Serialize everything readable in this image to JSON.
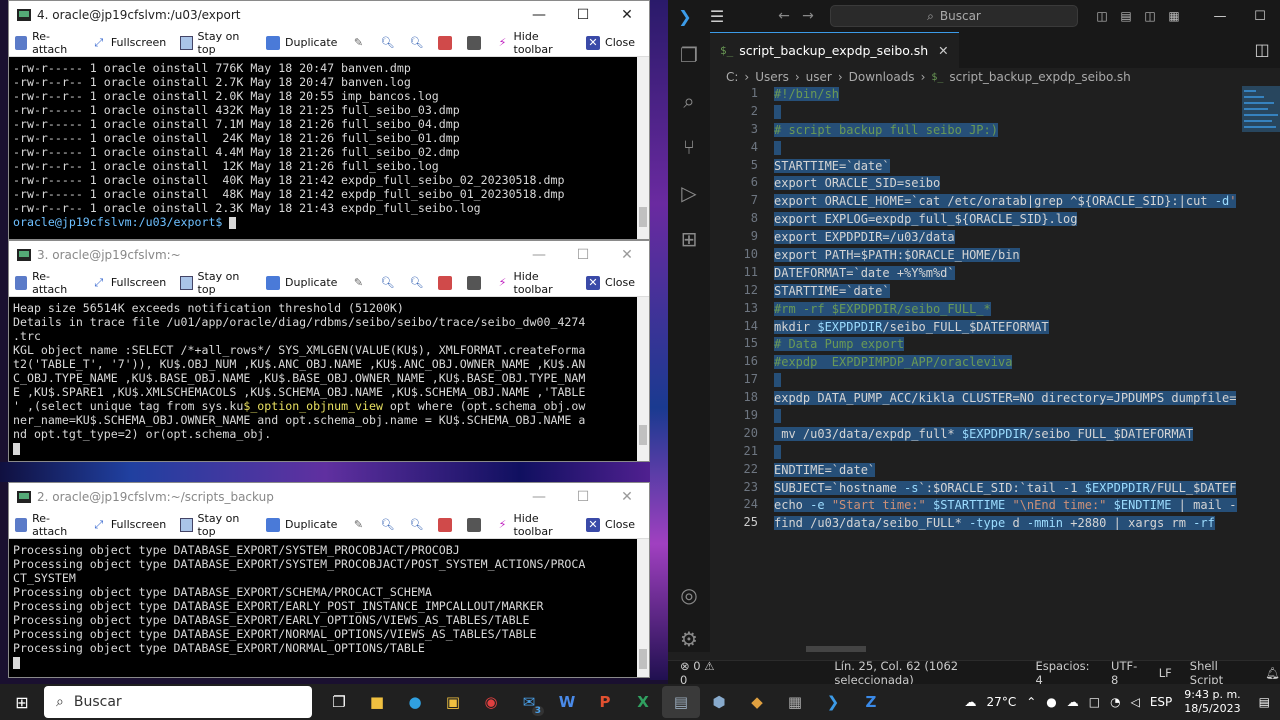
{
  "terminals": [
    {
      "title": "4. oracle@jp19cfslvm:/u03/export",
      "lines": [
        "-rw-r----- 1 oracle oinstall 776K May 18 20:47 banven.dmp",
        "-rw-r--r-- 1 oracle oinstall 2.7K May 18 20:47 banven.log",
        "-rw-r--r-- 1 oracle oinstall 2.0K May 18 20:55 imp_bancos.log",
        "-rw-r----- 1 oracle oinstall 432K May 18 21:25 full_seibo_03.dmp",
        "-rw-r----- 1 oracle oinstall 7.1M May 18 21:26 full_seibo_04.dmp",
        "-rw-r----- 1 oracle oinstall  24K May 18 21:26 full_seibo_01.dmp",
        "-rw-r----- 1 oracle oinstall 4.4M May 18 21:26 full_seibo_02.dmp",
        "-rw-r--r-- 1 oracle oinstall  12K May 18 21:26 full_seibo.log",
        "-rw-r----- 1 oracle oinstall  40K May 18 21:42 expdp_full_seibo_02_20230518.dmp",
        "-rw-r----- 1 oracle oinstall  48K May 18 21:42 expdp_full_seibo_01_20230518.dmp",
        "-rw-r--r-- 1 oracle oinstall 2.3K May 18 21:43 expdp_full_seibo.log"
      ],
      "prompt": "oracle@jp19cfslvm:/u03/export$ "
    },
    {
      "title": "3. oracle@jp19cfslvm:~",
      "lines": [
        "Heap size 56514K exceeds notification threshold (51200K)",
        "Details in trace file /u01/app/oracle/diag/rdbms/seibo/seibo/trace/seibo_dw00_4274",
        ".trc",
        "KGL object name :SELECT /*+all_rows*/ SYS_XMLGEN(VALUE(KU$), XMLFORMAT.createForma",
        "t2('TABLE_T', '7')), KU$.OBJ_NUM ,KU$.ANC_OBJ.NAME ,KU$.ANC_OBJ.OWNER_NAME ,KU$.AN",
        "C_OBJ.TYPE_NAME ,KU$.BASE_OBJ.NAME ,KU$.BASE_OBJ.OWNER_NAME ,KU$.BASE_OBJ.TYPE_NAM",
        "E ,KU$.SPARE1 ,KU$.XMLSCHEMACOLS ,KU$.SCHEMA_OBJ.NAME ,KU$.SCHEMA_OBJ.NAME ,'TABLE",
        "' ,(select unique tag from sys.ku$_option_objnum_view opt where (opt.schema_obj.ow",
        "ner_name=KU$.SCHEMA_OBJ.OWNER_NAME and opt.schema_obj.name = KU$.SCHEMA_OBJ.NAME a",
        "nd opt.tgt_type=2) or(opt.schema_obj."
      ]
    },
    {
      "title": "2. oracle@jp19cfslvm:~/scripts_backup",
      "lines": [
        "Processing object type DATABASE_EXPORT/SYSTEM_PROCOBJACT/PROCOBJ",
        "Processing object type DATABASE_EXPORT/SYSTEM_PROCOBJACT/POST_SYSTEM_ACTIONS/PROCA",
        "CT_SYSTEM",
        "Processing object type DATABASE_EXPORT/SCHEMA/PROCACT_SCHEMA",
        "Processing object type DATABASE_EXPORT/EARLY_POST_INSTANCE_IMPCALLOUT/MARKER",
        "Processing object type DATABASE_EXPORT/EARLY_OPTIONS/VIEWS_AS_TABLES/TABLE",
        "Processing object type DATABASE_EXPORT/NORMAL_OPTIONS/VIEWS_AS_TABLES/TABLE",
        "Processing object type DATABASE_EXPORT/NORMAL_OPTIONS/TABLE"
      ]
    }
  ],
  "toolbar": {
    "reattach": "Re-attach",
    "fullscreen": "Fullscreen",
    "stay_on_top": "Stay on top",
    "duplicate": "Duplicate",
    "hide_toolbar": "Hide toolbar",
    "close": "Close"
  },
  "vscode": {
    "search": "Buscar",
    "tab": "script_backup_expdp_seibo.sh",
    "breadcrumb": [
      "C:",
      "Users",
      "user",
      "Downloads",
      "script_backup_expdp_seibo.sh"
    ],
    "code": [
      "#!/bin/sh",
      "",
      "# script backup full seibo JP:)",
      "",
      "STARTTIME=`date`",
      "export ORACLE_SID=seibo",
      "export ORACLE_HOME=`cat /etc/oratab|grep ^${ORACLE_SID}:|cut -d'",
      "export EXPLOG=expdp_full_${ORACLE_SID}.log",
      "export EXPDPDIR=/u03/data",
      "export PATH=$PATH:$ORACLE_HOME/bin",
      "DATEFORMAT=`date +%Y%m%d`",
      "STARTTIME=`date`",
      "#rm -rf $EXPDPDIR/seibo_FULL_*",
      "mkdir $EXPDPDIR/seibo_FULL_$DATEFORMAT",
      "# Data Pump export",
      "#expdp  EXPDPIMPDP_APP/oracleviva",
      "",
      "expdp DATA_PUMP_ACC/kikla CLUSTER=NO directory=JPDUMPS dumpfile=",
      "",
      " mv /u03/data/expdp_full* $EXPDPDIR/seibo_FULL_$DATEFORMAT",
      "",
      "ENDTIME=`date`",
      "SUBJECT=`hostname -s`:$ORACLE_SID:`tail -1 $EXPDPDIR/FULL_$DATEF",
      "echo -e \"Start time:\" $STARTTIME \"\\nEnd time:\" $ENDTIME | mail -",
      "find /u03/data/seibo_FULL* -type d -mmin +2880 | xargs rm -rf"
    ],
    "status": {
      "problems": "0",
      "warnings": "0",
      "position": "Lín. 25, Col. 62 (1062 seleccionada)",
      "spaces": "Espacios: 4",
      "encoding": "UTF-8",
      "eol": "LF",
      "language": "Shell Script"
    }
  },
  "taskbar": {
    "search": "Buscar",
    "temperature": "27°C",
    "lang": "ESP",
    "time": "9:43 p. m.",
    "date": "18/5/2023",
    "mail_badge": "3"
  }
}
